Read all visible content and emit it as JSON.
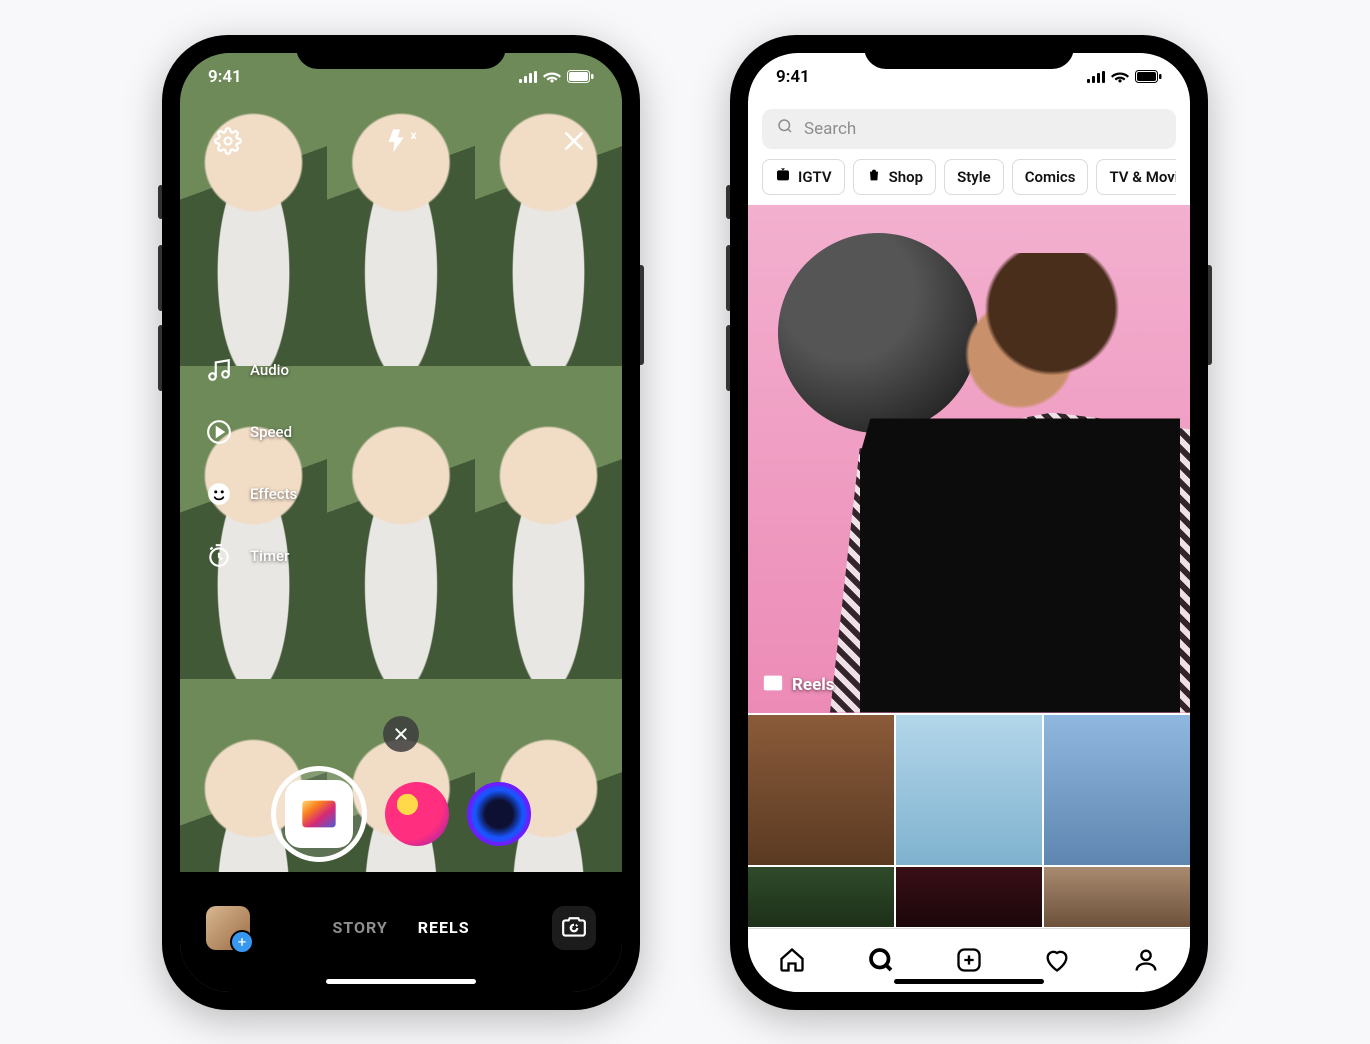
{
  "status": {
    "time": "9:41"
  },
  "camera": {
    "tools": {
      "audio": "Audio",
      "speed": "Speed",
      "effects": "Effects",
      "timer": "Timer"
    },
    "modes": {
      "story": "STORY",
      "reels": "REELS"
    }
  },
  "explore": {
    "search_placeholder": "Search",
    "chips": {
      "igtv": "IGTV",
      "shop": "Shop",
      "style": "Style",
      "comics": "Comics",
      "tvmovies": "TV & Movies"
    },
    "hero_badge": "Reels"
  }
}
